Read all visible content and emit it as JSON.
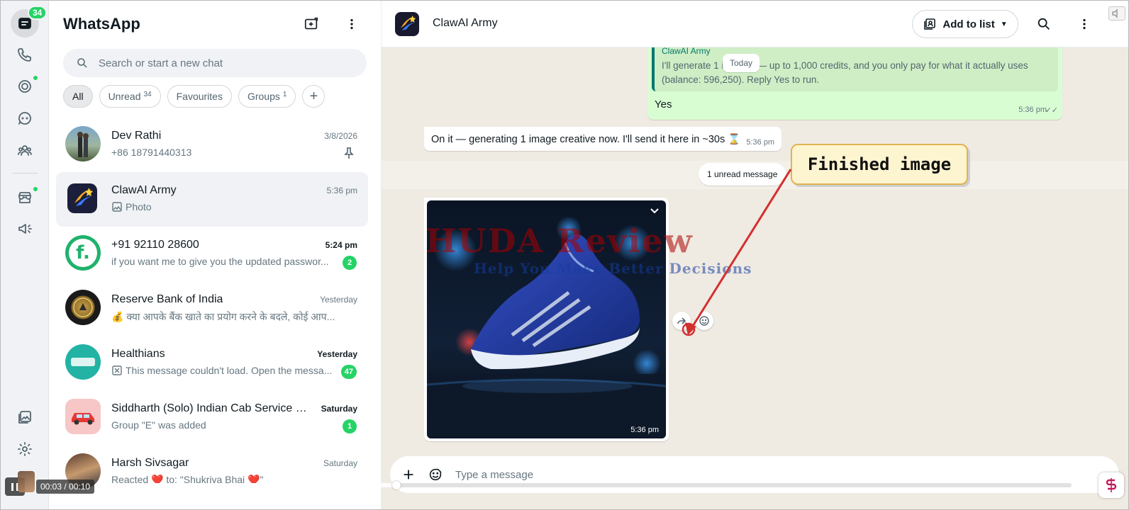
{
  "rail": {
    "chats_badge": "34"
  },
  "sidebar": {
    "title": "WhatsApp",
    "search_placeholder": "Search or start a new chat",
    "filters": [
      {
        "label": "All",
        "count": ""
      },
      {
        "label": "Unread",
        "count": "34"
      },
      {
        "label": "Favourites",
        "count": ""
      },
      {
        "label": "Groups",
        "count": "1"
      }
    ],
    "chats": [
      {
        "name": "Dev Rathi",
        "time": "3/8/2026",
        "preview": "+86 18791440313",
        "badge": "",
        "pinned": true
      },
      {
        "name": "ClawAI Army",
        "time": "5:36 pm",
        "preview": "Photo",
        "badge": "",
        "preview_icon": "photo-icon"
      },
      {
        "name": "+91 92110 28600",
        "time": "5:24 pm",
        "preview": "if you want me to give you the updated passwor...",
        "badge": "2"
      },
      {
        "name": "Reserve Bank of India",
        "time": "Yesterday",
        "preview": "💰 क्या आपके बैंक खाते का प्रयोग करने के बदले, कोई आप...",
        "badge": ""
      },
      {
        "name": "Healthians",
        "time": "Yesterday",
        "preview": "This message couldn't load. Open the messa...",
        "badge": "47",
        "preview_icon": "broken-message-icon"
      },
      {
        "name": "Siddharth (Solo) Indian Cab Service U...",
        "time": "Saturday",
        "preview": "Group \"E\" was added",
        "badge": "1"
      },
      {
        "name": "Harsh Sivsagar",
        "time": "Saturday",
        "preview": "Reacted ❤️ to: \"Shukriya Bhai ❤️\"",
        "badge": ""
      }
    ]
  },
  "main": {
    "title": "ClawAI Army",
    "add_to_list": "Add to list",
    "day_label": "Today",
    "quote_name": "ClawAI Army",
    "quote_text": "I'll generate 1 i... ative — up to 1,000 credits, and you only pay for what it actually uses (balance: 596,250). Reply Yes to run.",
    "out_text": "Yes",
    "out_time": "5:36 pm",
    "in_text": "On it — generating 1 image creative now. I'll send it here in ~30s ⌛",
    "in_time": "5:36 pm",
    "unread_label": "1 unread message",
    "image_time": "5:36 pm",
    "callout": "Finished image",
    "watermark_line1": "HUDA Review",
    "watermark_line2": "Help You Make Better Decisions",
    "composer_placeholder": "Type a message"
  },
  "player": {
    "timecode": "00:03 / 00:10",
    "progress": 0.3
  },
  "colors": {
    "accent": "#25d366",
    "chat_bg": "#efeae2",
    "outgoing_bubble": "#d9fdd3",
    "callout_border": "#e0b44e",
    "arrow": "#d32f2f"
  }
}
